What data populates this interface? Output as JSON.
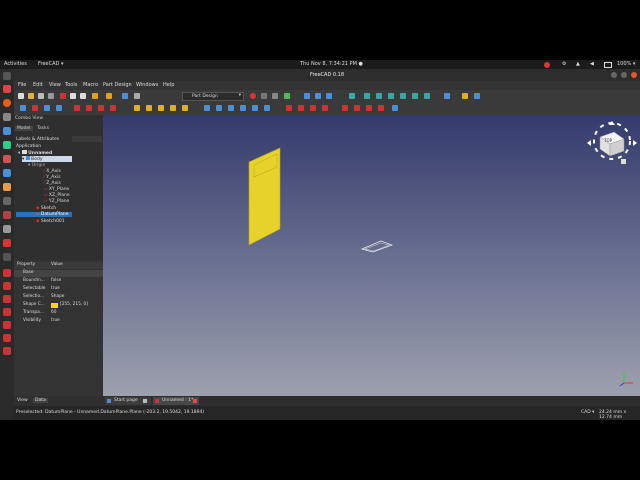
{
  "topbar": {
    "activities": "Activities",
    "app": "FreeCAD ▾",
    "clock": "Thu Nov 8, 7:34:21 PM ●",
    "battery": "100% ▾"
  },
  "window": {
    "title": "FreeCAD 0.18"
  },
  "menu": [
    "File",
    "Edit",
    "View",
    "Tools",
    "Macro",
    "Part Design",
    "Windows",
    "Help"
  ],
  "toolbar": {
    "workbench": "Part Design"
  },
  "combo": {
    "title": "Combo View",
    "tabs": [
      "Model",
      "Tasks"
    ],
    "section": "Labels & Attributes",
    "application": "Application",
    "tree": [
      "Unnamed",
      "Body",
      "Origin",
      "X_Axis",
      "Y_Axis",
      "Z_Axis",
      "XY_Plane",
      "XZ_Plane",
      "YZ_Plane",
      "Sketch",
      "DatumPlane",
      "Sketch001"
    ]
  },
  "properties": {
    "header": [
      "Property",
      "Value"
    ],
    "group": "Base",
    "rows": [
      {
        "name": "Boundin...",
        "value": "false"
      },
      {
        "name": "Selectable",
        "value": "true"
      },
      {
        "name": "Selectio...",
        "value": "Shape"
      },
      {
        "name": "Shape C...",
        "value": "[255, 215, 0]"
      },
      {
        "name": "Transpa...",
        "value": "60"
      },
      {
        "name": "Visibility",
        "value": "true"
      }
    ],
    "shape_color": "#ffd700"
  },
  "bottom_tabs": [
    "View",
    "Data"
  ],
  "doc_tabs": [
    "Start page",
    "Unnamed : 1*"
  ],
  "navcube": {
    "face": "TOP"
  },
  "status": {
    "message": "Preselected: DatumPlane - Unnamed.DatumPlane.Plane (-203.2, 19.5042, 19.1894)",
    "nav": "CAD ▾",
    "dims": "24.24 mm x 12.74 mm"
  }
}
